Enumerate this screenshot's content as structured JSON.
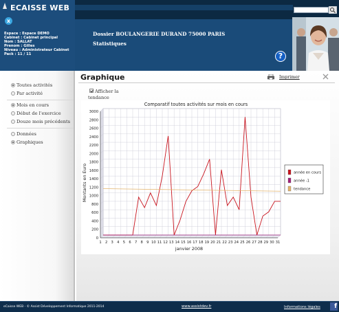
{
  "app": {
    "title": "ECAISSE WEB"
  },
  "user": {
    "lines": [
      "Espace : Espace DEMO",
      "Cabinet : Cabinet principal",
      "Nom : SALLAT",
      "Prenom : Gilles",
      "Niveau : Administrateur Cabinet",
      "Pack : 11 / 11"
    ]
  },
  "header": {
    "dossier": "Dossier BOULANGERIE DURAND 75000 PARIS",
    "section": "Statistiques",
    "search_value": "",
    "help": "?"
  },
  "sidebar": {
    "groups": [
      {
        "items": [
          {
            "label": "Toutes activités",
            "selected": true
          },
          {
            "label": "Par activité",
            "selected": false
          }
        ]
      },
      {
        "items": [
          {
            "label": "Mois en cours",
            "selected": true
          },
          {
            "label": "Début de l'exercice",
            "selected": false
          },
          {
            "label": "Douze mois précédents",
            "selected": false
          }
        ]
      },
      {
        "items": [
          {
            "label": "Données",
            "selected": false
          },
          {
            "label": "Graphiques",
            "selected": true
          }
        ]
      }
    ]
  },
  "main": {
    "title": "Graphique",
    "print_label": "Imprimer",
    "trend_checkbox_label": "Afficher la tendance",
    "trend_checked": true
  },
  "chart_data": {
    "type": "line",
    "title": "Comparatif toutes activités sur mois en cours",
    "xlabel": "janvier 2008",
    "ylabel": "Montants en Euro",
    "ylim": [
      0,
      3000
    ],
    "yticks": [
      0,
      200,
      400,
      600,
      800,
      1000,
      1200,
      1400,
      1600,
      1800,
      2000,
      2200,
      2400,
      2600,
      2800,
      3000
    ],
    "x": [
      1,
      2,
      3,
      4,
      5,
      6,
      7,
      8,
      9,
      10,
      11,
      12,
      13,
      14,
      15,
      16,
      17,
      18,
      19,
      20,
      21,
      22,
      23,
      24,
      25,
      26,
      27,
      28,
      29,
      30,
      31
    ],
    "series": [
      {
        "name": "année en cours",
        "color": "#c8141e",
        "values": [
          0,
          0,
          0,
          0,
          0,
          0,
          900,
          650,
          1000,
          700,
          1400,
          2350,
          0,
          350,
          800,
          1050,
          1150,
          1450,
          1800,
          0,
          1550,
          700,
          900,
          600,
          2800,
          900,
          0,
          450,
          550,
          800,
          800
        ]
      },
      {
        "name": "année -1",
        "color": "#a0207a",
        "values": [
          0,
          0,
          0,
          0,
          0,
          0,
          0,
          0,
          0,
          0,
          0,
          0,
          0,
          0,
          0,
          0,
          0,
          0,
          0,
          0,
          0,
          0,
          0,
          0,
          0,
          0,
          0,
          0,
          0,
          0,
          0
        ]
      },
      {
        "name": "tendance",
        "color": "#e3b36a",
        "values": [
          1100,
          1098,
          1096,
          1094,
          1092,
          1090,
          1088,
          1086,
          1084,
          1082,
          1080,
          1078,
          1076,
          1074,
          1072,
          1070,
          1068,
          1066,
          1064,
          1062,
          1060,
          1058,
          1056,
          1054,
          1052,
          1050,
          1048,
          1046,
          1044,
          1042,
          1040
        ]
      }
    ],
    "grid": true,
    "legend": "right"
  },
  "footer": {
    "copyright": "eCaisse WEB - © Assist Développement Informatique 2011-2014",
    "website": "www.assistdev.fr",
    "legal": "Informations légales",
    "facebook": "f"
  },
  "colors": {
    "navy": "#1a4b79",
    "dark_navy": "#0c2942",
    "accent_red": "#c8141e"
  }
}
